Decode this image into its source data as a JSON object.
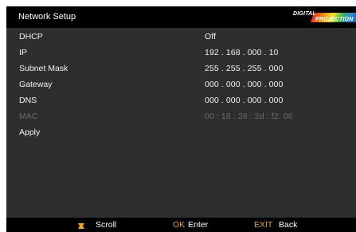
{
  "window": {
    "title": "Network Setup",
    "brand_top": "DIGITAL",
    "brand_bottom": "PROJECTION"
  },
  "menu": {
    "items": [
      {
        "label": "DHCP",
        "value": "Off"
      },
      {
        "label": "IP",
        "value": "192 . 168 . 000 . 10"
      },
      {
        "label": "Subnet Mask",
        "value": "255 . 255 . 255 . 000"
      },
      {
        "label": "Gateway",
        "value": "000 . 000 . 000 . 000"
      },
      {
        "label": "DNS",
        "value": "000 . 000 . 000 . 000"
      },
      {
        "label": "MAC",
        "value": "00 : 18 : 28 : 2d : f2: 06",
        "disabled": true
      },
      {
        "label": "Apply",
        "value": ""
      }
    ]
  },
  "footer": {
    "scroll_label": "Scroll",
    "ok_key": "OK",
    "ok_label": "Enter",
    "exit_key": "EXIT",
    "exit_label": "Back"
  },
  "colors": {
    "background": "#2e2e2e",
    "bar": "#000000",
    "accent": "#f2a21a",
    "text": "#f2f2f2",
    "disabled": "#6a6a6a"
  },
  "icons": [
    "scroll-down-icon",
    "scroll-up-icon"
  ]
}
